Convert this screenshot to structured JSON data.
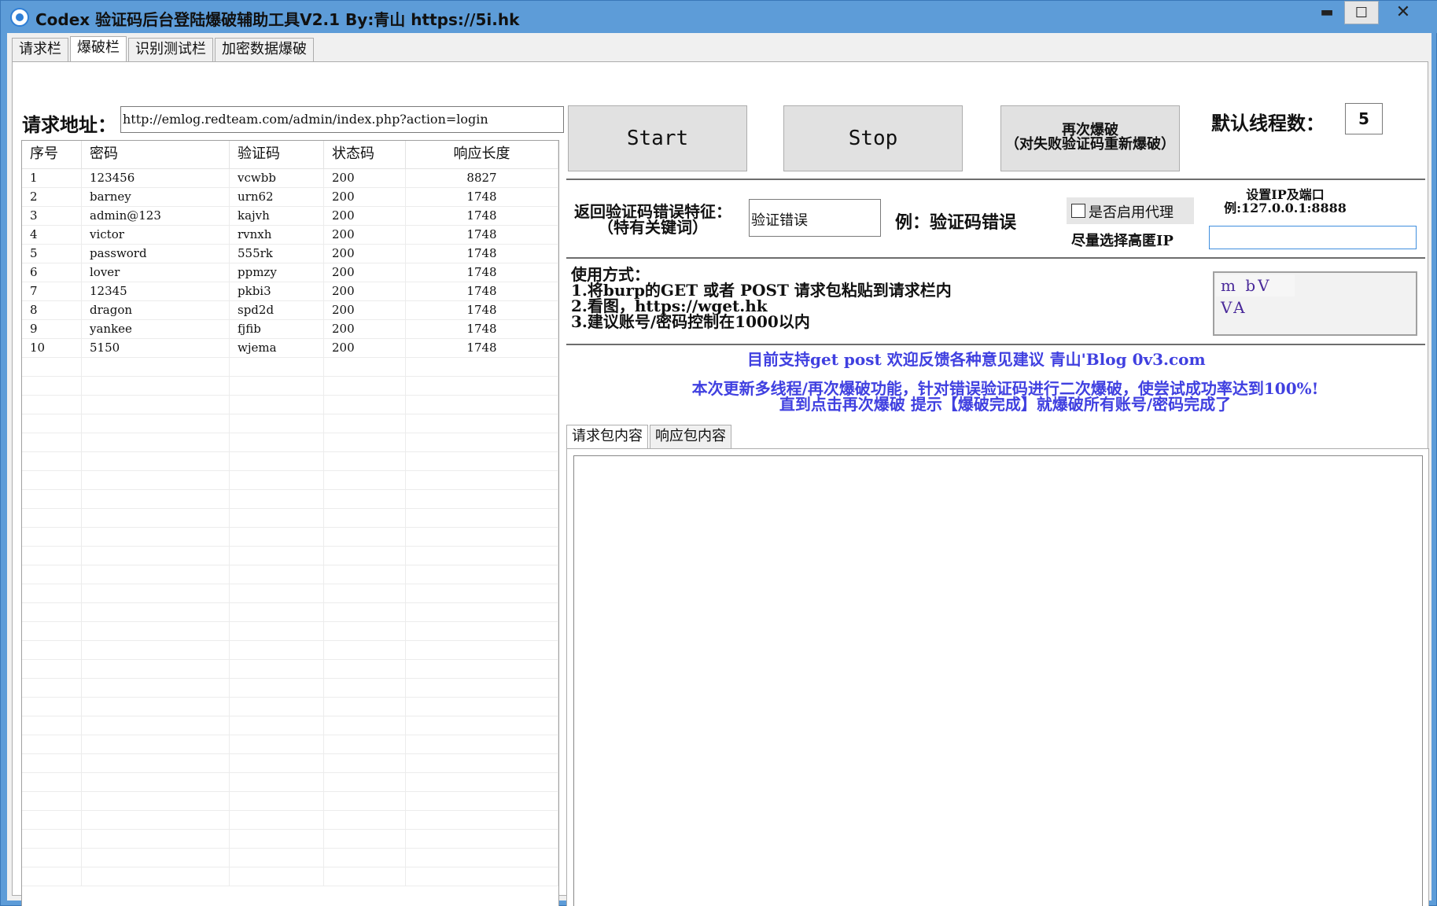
{
  "window": {
    "title": "Codex 验证码后台登陆爆破辅助工具V2.1   By:青山 https://5i.hk",
    "min_symbol": "▬",
    "max_symbol": "☐",
    "close_symbol": "✕"
  },
  "tabs": [
    "请求栏",
    "爆破栏",
    "识别测试栏",
    "加密数据爆破"
  ],
  "active_tab": 1,
  "url": {
    "label": "请求地址：",
    "value": "http://emlog.redteam.com/admin/index.php?action=login"
  },
  "table": {
    "headers": [
      "序号",
      "密码",
      "验证码",
      "状态码",
      "响应长度"
    ],
    "rows": [
      [
        "1",
        "123456",
        "vcwbb",
        "200",
        "8827"
      ],
      [
        "2",
        "barney",
        "urn62",
        "200",
        "1748"
      ],
      [
        "3",
        "admin@123",
        "kajvh",
        "200",
        "1748"
      ],
      [
        "4",
        "victor",
        "rvnxh",
        "200",
        "1748"
      ],
      [
        "5",
        "password",
        "555rk",
        "200",
        "1748"
      ],
      [
        "6",
        "lover",
        "ppmzy",
        "200",
        "1748"
      ],
      [
        "7",
        "12345",
        "pkbi3",
        "200",
        "1748"
      ],
      [
        "8",
        "dragon",
        "spd2d",
        "200",
        "1748"
      ],
      [
        "9",
        "yankee",
        "fjfib",
        "200",
        "1748"
      ],
      [
        "10",
        "5150",
        "wjema",
        "200",
        "1748"
      ]
    ]
  },
  "buttons": {
    "start": "Start",
    "stop": "Stop",
    "rerun_line1": "再次爆破",
    "rerun_line2": "（对失败验证码重新爆破）"
  },
  "threads": {
    "label": "默认线程数：",
    "value": "5"
  },
  "feature": {
    "label_line1": "返回验证码错误特征：",
    "label_line2": "（特有关键词）",
    "value": "验证错误",
    "example": "例：验证码错误"
  },
  "proxy": {
    "checkbox_label": "是否启用代理",
    "checked": false,
    "hint": "尽量选择高匿IP",
    "ip_label_line1": "设置IP及端口",
    "ip_label_line2": "例:127.0.0.1:8888",
    "ip_value": ""
  },
  "usage": {
    "title": "使用方式：",
    "line1": "1.将burp的GET 或者 POST 请求包粘贴到请求栏内",
    "line2": "2.看图，https://wget.hk",
    "line3": "3.建议账号/密码控制在1000以内"
  },
  "captcha": {
    "text": "m bV VA"
  },
  "notices": {
    "line1": "目前支持get post 欢迎反馈各种意见建议 青山'Blog 0v3.com",
    "line2": "本次更新多线程/再次爆破功能，针对错误验证码进行二次爆破，使尝试成功率达到100%!",
    "line3": "直到点击再次爆破 提示【爆破完成】就爆破所有账号/密码完成了"
  },
  "inner_tabs": [
    "请求包内容",
    "响应包内容"
  ],
  "colors": {
    "titlebar": "#5d9cd8",
    "notice_text": "#4040e0",
    "panel": "#f0f0f0"
  }
}
